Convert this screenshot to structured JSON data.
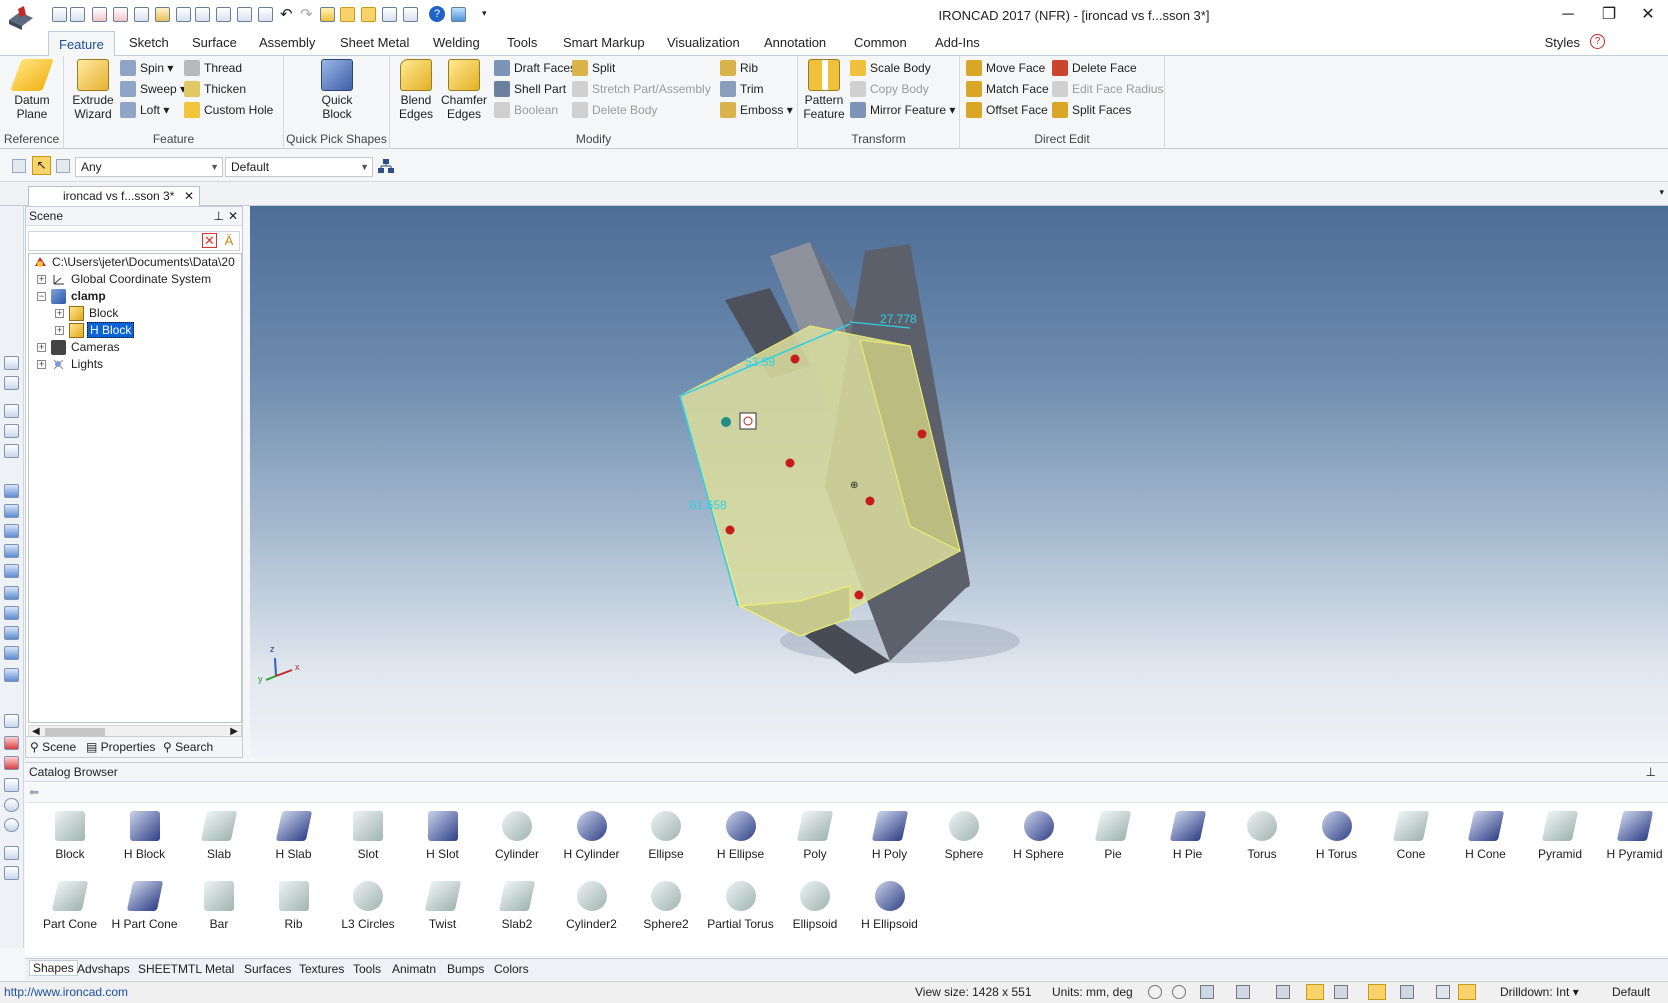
{
  "window": {
    "title": "IRONCAD 2017 (NFR) - [ironcad vs f...sson 3*]",
    "minimize": "─",
    "restore": "❐",
    "close": "✕"
  },
  "ribbon_tabs": [
    "Feature",
    "Sketch",
    "Surface",
    "Assembly",
    "Sheet Metal",
    "Welding",
    "Tools",
    "Smart Markup",
    "Visualization",
    "Annotation",
    "Common",
    "Add-Ins"
  ],
  "styles_label": "Styles",
  "ribbon": {
    "reference": {
      "label": "Reference",
      "datum_plane": "Datum",
      "datum_plane2": "Plane"
    },
    "feature": {
      "label": "Feature",
      "extrude": "Extrude",
      "extrude2": "Wizard",
      "spin": "Spin",
      "sweep": "Sweep",
      "loft": "Loft",
      "thread": "Thread",
      "thicken": "Thicken",
      "custom_hole": "Custom Hole"
    },
    "quick_pick": {
      "label": "Quick Pick Shapes",
      "quick_block": "Quick",
      "quick_block2": "Block"
    },
    "modify": {
      "label": "Modify",
      "blend": "Blend",
      "blend2": "Edges",
      "chamfer": "Chamfer",
      "chamfer2": "Edges",
      "draft_faces": "Draft Faces",
      "shell_part": "Shell Part",
      "boolean": "Boolean",
      "split": "Split",
      "stretch": "Stretch Part/Assembly",
      "delete_body": "Delete Body",
      "rib": "Rib",
      "trim": "Trim",
      "emboss": "Emboss"
    },
    "transform": {
      "label": "Transform",
      "pattern": "Pattern",
      "pattern2": "Feature",
      "scale_body": "Scale Body",
      "copy_body": "Copy Body",
      "mirror_feature": "Mirror Feature"
    },
    "direct_edit": {
      "label": "Direct Edit",
      "move_face": "Move Face",
      "match_face": "Match Face",
      "offset_face": "Offset Face",
      "delete_face": "Delete Face",
      "edit_face_radius": "Edit Face Radius",
      "split_faces": "Split Faces"
    }
  },
  "selbar": {
    "filter": "Any",
    "style": "Default"
  },
  "doc_tab": "ironcad vs f...sson 3*",
  "scene": {
    "title": "Scene",
    "tree": [
      {
        "label": "C:\\Users\\jeter\\Documents\\Data\\20",
        "level": 0
      },
      {
        "label": "Global Coordinate System",
        "level": 1
      },
      {
        "label": "clamp",
        "level": 1
      },
      {
        "label": "Block",
        "level": 2
      },
      {
        "label": "H Block",
        "level": 2
      },
      {
        "label": "Cameras",
        "level": 1
      },
      {
        "label": "Lights",
        "level": 1
      }
    ],
    "tabs": [
      "Scene",
      "Properties",
      "Search"
    ]
  },
  "viewport": {
    "dim_top": "27.778",
    "dim_width": "53.59",
    "dim_height": "61.658",
    "axis_z": "z",
    "axis_x": "x",
    "axis_y": "y"
  },
  "catalog": {
    "title": "Catalog Browser",
    "row1": [
      "Block",
      "H Block",
      "Slab",
      "H Slab",
      "Slot",
      "H Slot",
      "Cylinder",
      "H Cylinder",
      "Ellipse",
      "H Ellipse",
      "Poly",
      "H Poly",
      "Sphere",
      "H Sphere",
      "Pie",
      "H Pie",
      "Torus",
      "H Torus",
      "Cone",
      "H Cone",
      "Pyramid",
      "H Pyramid"
    ],
    "row2": [
      "Part Cone",
      "H Part Cone",
      "Bar",
      "Rib",
      "L3 Circles",
      "Twist",
      "Slab2",
      "Cylinder2",
      "Sphere2",
      "Partial Torus",
      "Ellipsoid",
      "H Ellipsoid"
    ],
    "tabs": [
      "Shapes",
      "Advshaps",
      "SHEETMTL",
      "Metal",
      "Surfaces",
      "Textures",
      "Tools",
      "Animatn",
      "Bumps",
      "Colors"
    ]
  },
  "status": {
    "url": "http://www.ironcad.com",
    "view_size": "View size: 1428 x  551",
    "units": "Units: mm, deg",
    "drilldown": "Drilldown: Int",
    "default": "Default"
  },
  "colors": {
    "accent": "#1b4f9c",
    "selection": "#0a64d8",
    "highlight_face": "#d9dc9e",
    "body": "#5f6370"
  }
}
